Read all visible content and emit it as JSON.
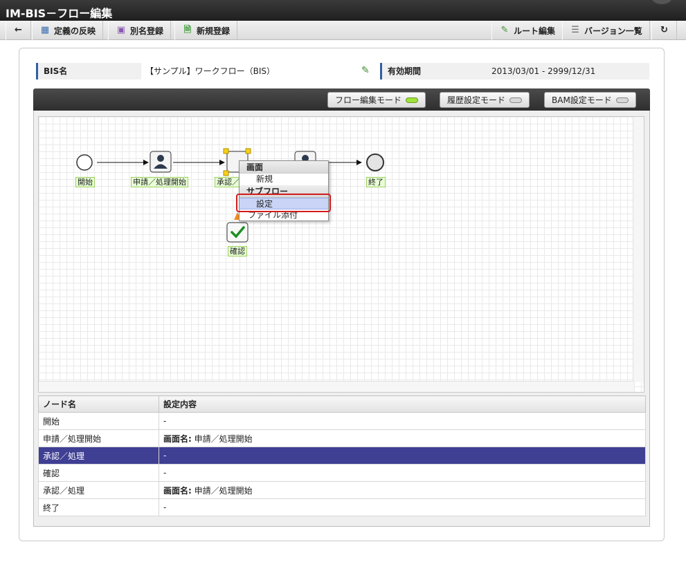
{
  "window": {
    "title": "IM-BIS－フロー編集"
  },
  "toolbar": {
    "back_icon": "arrow-left-icon",
    "reflect_label": "定義の反映",
    "alias_label": "別名登録",
    "new_label": "新規登録",
    "route_label": "ルート編集",
    "version_label": "バージョン一覧",
    "refresh_icon": "refresh-icon"
  },
  "info": {
    "bis_label": "BIS名",
    "bis_value": "【サンプル】ワークフロー（BIS）",
    "period_label": "有効期間",
    "period_value": "2013/03/01 - 2999/12/31"
  },
  "modes": {
    "flow_edit": "フロー編集モード",
    "history": "履歴設定モード",
    "bam": "BAM設定モード",
    "active": "flow_edit"
  },
  "canvas": {
    "nodes": {
      "start": "開始",
      "apply": "申請／処理開始",
      "approve": "承認／",
      "end": "終了",
      "confirm": "確認"
    }
  },
  "context_menu": {
    "group_screen": "画面",
    "item_new": "新規",
    "group_subflow": "サブフロー",
    "item_settings": "設定",
    "item_attach": "ファイル添付"
  },
  "table": {
    "headers": [
      "ノード名",
      "設定内容"
    ],
    "rows": [
      {
        "name": "開始",
        "bold": "",
        "value": "-"
      },
      {
        "name": "申請／処理開始",
        "bold": "画面名:",
        "value": " 申請／処理開始"
      },
      {
        "name": "承認／処理",
        "bold": "",
        "value": "-"
      },
      {
        "name": "確認",
        "bold": "",
        "value": "-"
      },
      {
        "name": "承認／処理",
        "bold": "画面名:",
        "value": " 申請／処理開始"
      },
      {
        "name": "終了",
        "bold": "",
        "value": "-"
      }
    ],
    "selected_row": 2
  },
  "colors": {
    "selected_row_bg": "#3f3f94",
    "highlight": "#d31b1b",
    "led_on": "#9ee23a"
  }
}
